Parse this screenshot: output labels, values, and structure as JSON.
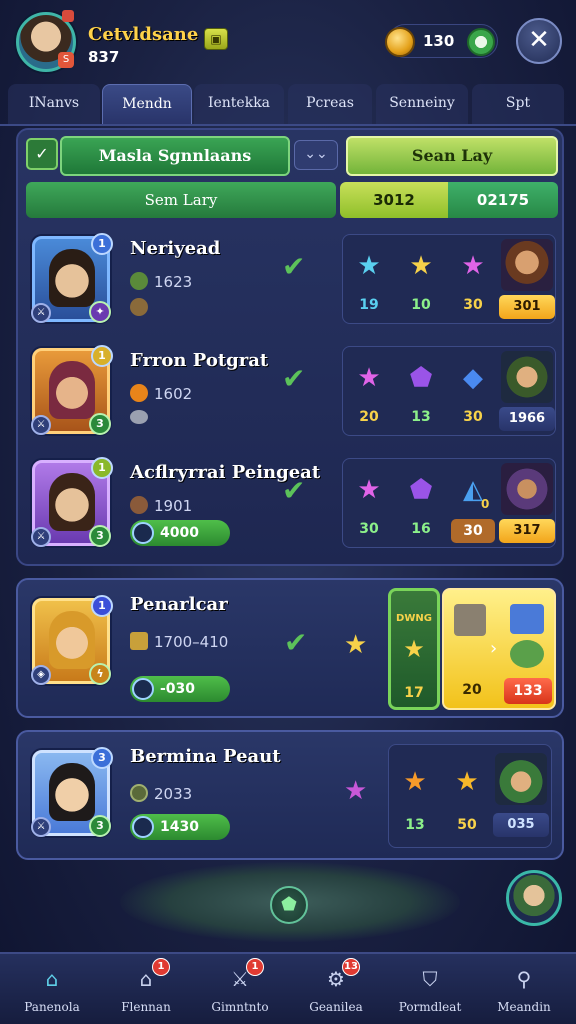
{
  "header": {
    "player_name": "Cetvldsane",
    "player_level": "837",
    "coins": "130",
    "close_label": "✕"
  },
  "tabs": [
    {
      "label": "INanvs",
      "active": false
    },
    {
      "label": "Mendn",
      "active": true
    },
    {
      "label": "Ientekka",
      "active": false
    },
    {
      "label": "Pcreas",
      "active": false
    },
    {
      "label": "Senneiny",
      "active": false
    },
    {
      "label": "Spt",
      "active": false
    }
  ],
  "panel": {
    "check_label": "✓",
    "mode_title": "Masla Sgnnlaans",
    "more_label": "⌄⌄",
    "sort_label": "Sean Lay",
    "bar_left": "Sem Lary",
    "bar_mid": "3012",
    "bar_right": "02175"
  },
  "rows": [
    {
      "name": "Neriyead",
      "stat": "1623",
      "level": "1",
      "rewards": [
        "19",
        "10",
        "30"
      ],
      "tag": "301"
    },
    {
      "name": "Frron Potgrat",
      "stat": "1602",
      "level": "1",
      "rewards": [
        "20",
        "13",
        "30"
      ],
      "tag": "1966"
    },
    {
      "name": "Acflryrrai Peingeat",
      "stat": "1901",
      "pill": "4000",
      "level": "1",
      "rewards": [
        "30",
        "16",
        "30"
      ],
      "small_label": "0",
      "tag": "317"
    }
  ],
  "featured": {
    "name": "Penarlcar",
    "stat": "1700–410",
    "pill": "-030",
    "level": "1",
    "box_label": "DWNG",
    "rewards": [
      "17",
      "20"
    ],
    "tag": "133"
  },
  "last": {
    "name": "Bermina Peaut",
    "stat": "2033",
    "pill": "1430",
    "level": "3",
    "rewards": [
      "13",
      "50"
    ],
    "tag": "035"
  },
  "nav": [
    {
      "label": "Panenola",
      "badge": ""
    },
    {
      "label": "Flennan",
      "badge": "1"
    },
    {
      "label": "Gimntnto",
      "badge": "1"
    },
    {
      "label": "Geanilea",
      "badge": "13"
    },
    {
      "label": "Pormdleat",
      "badge": ""
    },
    {
      "label": "Meandin",
      "badge": ""
    }
  ],
  "colors": {
    "accent_green": "#3aa454",
    "gold": "#f7d24a",
    "panel": "#283463"
  }
}
